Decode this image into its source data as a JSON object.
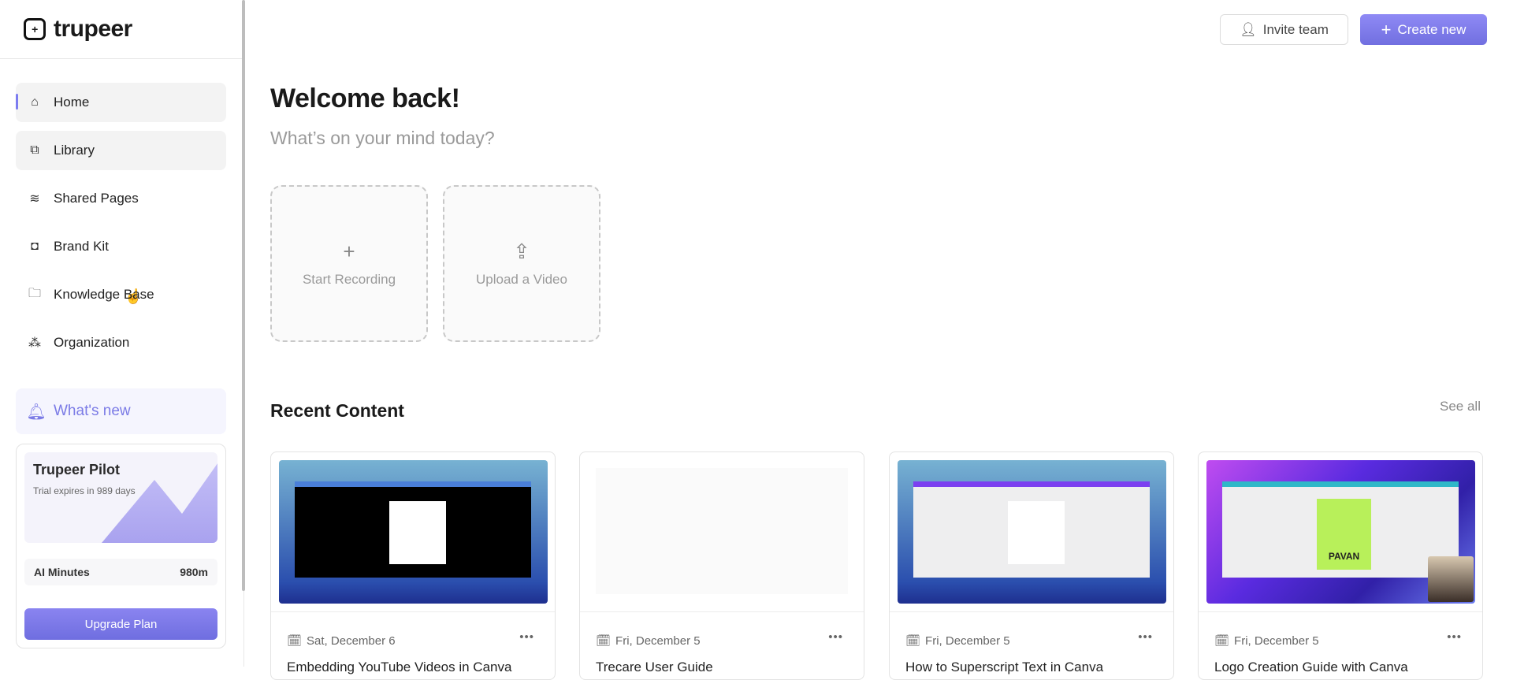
{
  "app": {
    "logo_text": "trupeer"
  },
  "sidebar": {
    "items": [
      {
        "label": "Home",
        "icon": "home-icon"
      },
      {
        "label": "Library",
        "icon": "library-icon"
      },
      {
        "label": "Shared Pages",
        "icon": "layers-icon"
      },
      {
        "label": "Brand Kit",
        "icon": "brand-icon"
      },
      {
        "label": "Knowledge Base",
        "icon": "folder-icon"
      },
      {
        "label": "Organization",
        "icon": "people-icon"
      }
    ],
    "whats_new": "What's new",
    "plan": {
      "title": "Trupeer Pilot",
      "subtitle": "Trial expires in 989 days",
      "minutes_label": "AI Minutes",
      "minutes_value": "980m",
      "upgrade": "Upgrade Plan"
    }
  },
  "header": {
    "invite": "Invite team",
    "create": "Create new"
  },
  "main": {
    "title": "Welcome back!",
    "subtitle": "What’s on your mind today?",
    "tiles": [
      {
        "label": "Start Recording",
        "icon": "plus-icon"
      },
      {
        "label": "Upload a Video",
        "icon": "upload-icon"
      }
    ],
    "recent_title": "Recent Content",
    "see_all": "See all",
    "cards": [
      {
        "date": "Sat, December 6",
        "title": "Embedding YouTube Videos in Canva"
      },
      {
        "date": "Fri, December 5",
        "title": "Trecare User Guide"
      },
      {
        "date": "Fri, December 5",
        "title": "How to Superscript Text in Canva"
      },
      {
        "date": "Fri, December 5",
        "title": "Logo Creation Guide with Canva",
        "thumb_text": "PAVAN"
      }
    ],
    "more": "•••"
  },
  "colors": {
    "accent": "#7c7cf0"
  }
}
